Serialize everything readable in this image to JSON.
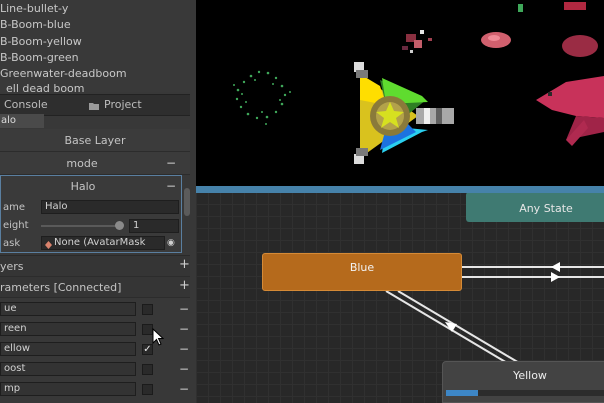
{
  "hierarchy": {
    "items": [
      "Line-bullet-y",
      "B-Boom-blue",
      "B-Boom-yellow",
      "B-Boom-green",
      "Greenwater-deadboom",
      "ell dead boom"
    ]
  },
  "tabs": {
    "console_label": "Console",
    "project_label": "Project"
  },
  "breadcrumb": {
    "label": "alo"
  },
  "layers_panel": {
    "base_layer_label": "Base Layer",
    "mode_layer_label": "mode",
    "halo_layer_label": "Halo",
    "name_label": "ame",
    "name_value": "Halo",
    "weight_label": "eight",
    "weight_value": "1",
    "mask_label": "ask",
    "mask_value": "None (AvatarMask",
    "layers_header": "yers",
    "parameters_header": "rameters [Connected]"
  },
  "parameters": [
    {
      "label": "ue",
      "checked": false
    },
    {
      "label": "reen",
      "checked": false
    },
    {
      "label": "ellow",
      "checked": true
    },
    {
      "label": "oost",
      "checked": false
    },
    {
      "label": "mp",
      "checked": false
    }
  ],
  "symbols": {
    "plus": "+",
    "minus": "−",
    "check": "✓",
    "dot": "◉"
  },
  "animator": {
    "any_state_label": "Any State",
    "blue_state_label": "Blue",
    "yellow_state_label": "Yellow",
    "yellow_progress": 0.2
  },
  "colors": {
    "accent_frame": "#4682aa",
    "blue_state": "#b56a1c",
    "any_state": "#3f7a72",
    "yellow_state": "#434343",
    "progress": "#3d86c6"
  }
}
